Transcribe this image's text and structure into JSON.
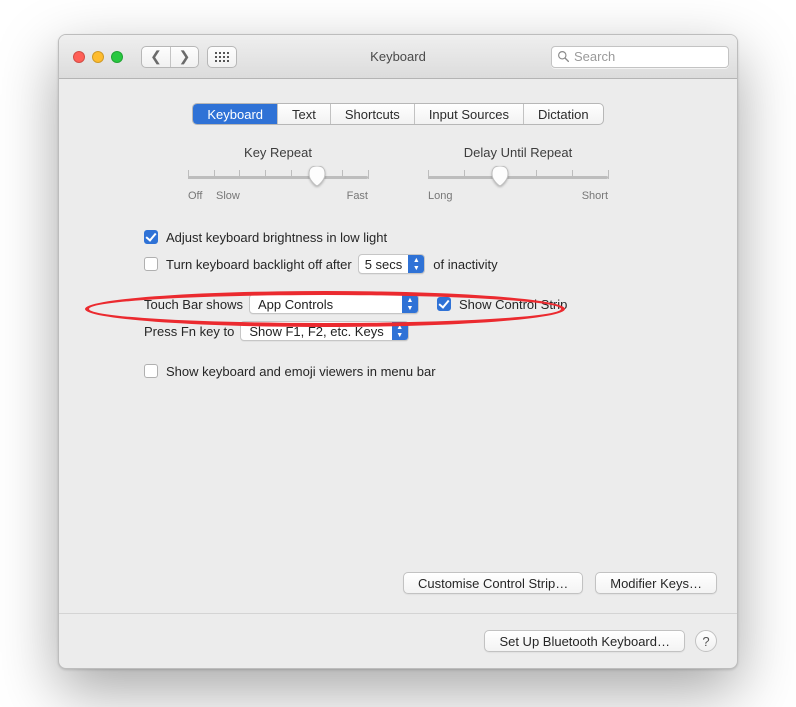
{
  "window": {
    "title": "Keyboard"
  },
  "toolbar": {
    "search_placeholder": "Search"
  },
  "tabs": {
    "items": [
      {
        "label": "Keyboard",
        "active": true
      },
      {
        "label": "Text"
      },
      {
        "label": "Shortcuts"
      },
      {
        "label": "Input Sources"
      },
      {
        "label": "Dictation"
      }
    ]
  },
  "sliders": {
    "key_repeat": {
      "title": "Key Repeat",
      "left_label1": "Off",
      "left_label2": "Slow",
      "right_label": "Fast",
      "ticks": 8,
      "value_index": 5
    },
    "delay": {
      "title": "Delay Until Repeat",
      "left_label": "Long",
      "right_label": "Short",
      "ticks": 6,
      "value_index": 2
    }
  },
  "options": {
    "adjust_brightness": {
      "label": "Adjust keyboard brightness in low light",
      "checked": true
    },
    "backlight_off": {
      "label_before": "Turn keyboard backlight off after",
      "label_after": "of inactivity",
      "checked": false,
      "value": "5 secs"
    },
    "touchbar": {
      "label": "Touch Bar shows",
      "value": "App Controls",
      "show_control_strip_label": "Show Control Strip",
      "show_control_strip_checked": true
    },
    "fn_key": {
      "label": "Press Fn key to",
      "value": "Show F1, F2, etc. Keys"
    },
    "menubar_viewer": {
      "label": "Show keyboard and emoji viewers in menu bar",
      "checked": false
    }
  },
  "buttons": {
    "customise": "Customise Control Strip…",
    "modifier": "Modifier Keys…",
    "bluetooth": "Set Up Bluetooth Keyboard…",
    "help": "?"
  }
}
